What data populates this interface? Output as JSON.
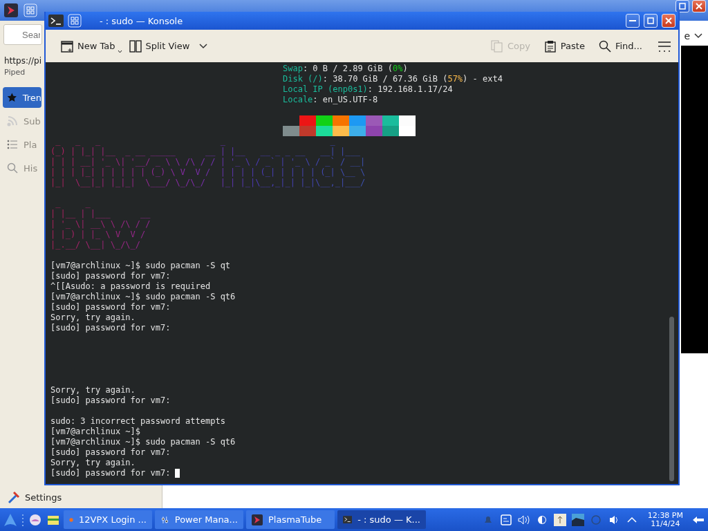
{
  "background_app": {
    "search": {
      "placeholder": "Sear"
    },
    "url": "https://pi",
    "instance": "Piped",
    "sidebar": {
      "items": [
        {
          "label": "Tren",
          "selected": true,
          "disabled": false
        },
        {
          "label": "Sub",
          "selected": false,
          "disabled": true
        },
        {
          "label": "Pla",
          "selected": false,
          "disabled": true
        },
        {
          "label": "His",
          "selected": false,
          "disabled": true
        }
      ]
    },
    "combo_tail": "e",
    "settings": "Settings"
  },
  "window": {
    "title": "- : sudo — Konsole"
  },
  "toolbar": {
    "items": [
      {
        "kind": "newtab",
        "label": "New Tab",
        "disabled": false
      },
      {
        "kind": "split",
        "label": "Split View",
        "disabled": false
      },
      {
        "kind": "copy",
        "label": "Copy",
        "disabled": true
      },
      {
        "kind": "paste",
        "label": "Paste",
        "disabled": false
      },
      {
        "kind": "find",
        "label": "Find...",
        "disabled": false
      }
    ]
  },
  "terminal": {
    "info": [
      [
        {
          "kind": "label",
          "text": "Swap"
        },
        {
          "kind": "text",
          "text": ": 0 B / 2.89 GiB ("
        },
        {
          "kind": "good",
          "text": "0%"
        },
        {
          "kind": "text",
          "text": ")"
        }
      ],
      [
        {
          "kind": "label",
          "text": "Disk (/)"
        },
        {
          "kind": "text",
          "text": ": 38.70 GiB / 67.36 GiB ("
        },
        {
          "kind": "warn",
          "text": "57%"
        },
        {
          "kind": "text",
          "text": ") - ext4"
        }
      ],
      [
        {
          "kind": "label",
          "text": "Local IP (enp0s1)"
        },
        {
          "kind": "text",
          "text": ": 192.168.1.17/24"
        }
      ],
      [
        {
          "kind": "label",
          "text": "Locale"
        },
        {
          "kind": "text",
          "text": ": en_US.UTF-8"
        }
      ]
    ],
    "swatches": [
      [
        {
          "color": "#ed1515"
        },
        {
          "color": "#11d116"
        },
        {
          "color": "#f67400"
        },
        {
          "color": "#1d99f3"
        },
        {
          "color": "#9b59b6"
        },
        {
          "color": "#1abc9c"
        },
        {
          "color": "#fcfcfc"
        }
      ],
      [
        {
          "color": "#7f8c8d"
        },
        {
          "color": "#c0392b"
        },
        {
          "color": "#1cdc9a"
        },
        {
          "color": "#fdbc4b"
        },
        {
          "color": "#3daee9"
        },
        {
          "color": "#8e44ad"
        },
        {
          "color": "#16a085"
        },
        {
          "color": "#ffffff"
        }
      ]
    ],
    "ascii_art": [
      [
        " _   _   _                        _                     _     ",
        "(_) | |_| |__  _ __ _____      __ | |__   __ _ _ __   __| |___ ",
        "| | | __| '_ \\| '__/ _ \\ \\ /\\ / / | '_ \\ / _` | '_ \\ / _` / __|",
        "| | | |_| | | | | | (_) \\ V  V /  | | | | (_| | | | | (_| \\__ \\",
        "|_|  \\__|_| |_|_|  \\___/ \\_/\\_/   |_| |_|\\__,_|_| |_|\\__,_|___/"
      ],
      [
        " _     _",
        "| |__ | |___      __",
        "| '_ \\| __\\ \\ /\\ / /",
        "| |_) | |_ \\ V  V /",
        "|_.__/ \\__| \\_/\\_/"
      ]
    ],
    "lines": [
      {
        "kind": "text",
        "text": "[vm7@archlinux ~]$ sudo pacman -S qt"
      },
      {
        "kind": "text",
        "text": "[sudo] password for vm7:"
      },
      {
        "kind": "text",
        "text": "^[[Asudo: a password is required"
      },
      {
        "kind": "text",
        "text": "[vm7@archlinux ~]$ sudo pacman -S qt6"
      },
      {
        "kind": "text",
        "text": "[sudo] password for vm7:"
      },
      {
        "kind": "text",
        "text": "Sorry, try again."
      },
      {
        "kind": "text",
        "text": "[sudo] password for vm7:"
      },
      {
        "kind": "blank"
      },
      {
        "kind": "blank"
      },
      {
        "kind": "blank"
      },
      {
        "kind": "blank"
      },
      {
        "kind": "blank"
      },
      {
        "kind": "text",
        "text": "Sorry, try again."
      },
      {
        "kind": "text",
        "text": "[sudo] password for vm7:"
      },
      {
        "kind": "blank"
      },
      {
        "kind": "text",
        "text": "sudo: 3 incorrect password attempts"
      },
      {
        "kind": "text",
        "text": "[vm7@archlinux ~]$"
      },
      {
        "kind": "text",
        "text": "[vm7@archlinux ~]$ sudo pacman -S qt6"
      },
      {
        "kind": "text",
        "text": "[sudo] password for vm7:"
      },
      {
        "kind": "text",
        "text": "Sorry, try again."
      },
      {
        "kind": "text",
        "text": "[sudo] password for vm7:",
        "cursor": true
      }
    ]
  },
  "taskbar": {
    "tasks": [
      {
        "label": "12VPX Login ...",
        "selected": false
      },
      {
        "label": "Power Mana...",
        "selected": false
      },
      {
        "label": "PlasmaTube",
        "selected": false
      },
      {
        "label": "- : sudo — K...",
        "selected": true
      }
    ],
    "time": "12:38 PM",
    "date": "11/4/24"
  }
}
